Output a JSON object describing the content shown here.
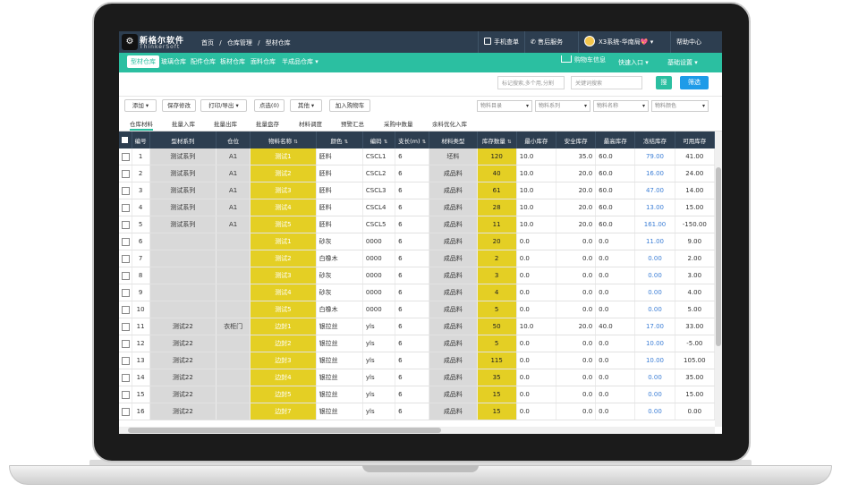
{
  "header": {
    "logo_cn": "新格尔软件",
    "logo_en": "ThinkerSoft",
    "breadcrumb": [
      "首页",
      "/",
      "仓库管理",
      "/",
      "型材仓库"
    ],
    "mobile_order": "手机查单",
    "after_sales": "售后服务",
    "system_user": "X3系统-华南局💖",
    "help": "帮助中心"
  },
  "nav": {
    "items": [
      "型材仓库",
      "玻璃仓库",
      "配件仓库",
      "板材仓库",
      "面料仓库",
      "半成品仓库"
    ],
    "cart": "购物车信息",
    "quick_entry": "快速入口",
    "settings": "基础设置"
  },
  "search": {
    "tag_placeholder": "标记搜索,多个用,分割",
    "keyword_placeholder": "关键词搜索",
    "search_btn": "搜",
    "filter_btn": "筛选"
  },
  "toolbar": {
    "add": "添加",
    "save": "保存修改",
    "print": "打印/导出",
    "selected": "点选(0)",
    "other": "其他",
    "add_cart": "加入购物车",
    "selects": [
      "物料目录",
      "物料系列",
      "物料名称",
      "物料颜色"
    ]
  },
  "subtabs": [
    "仓库材料",
    "批量入库",
    "批量出库",
    "批量盘存",
    "材料调度",
    "预警汇总",
    "采购中数量",
    "余料优化入库"
  ],
  "table": {
    "headers": [
      "编号",
      "型材系列",
      "仓位",
      "物料名称",
      "颜色",
      "编码",
      "支长(m)",
      "材料类型",
      "库存数量",
      "最小库存",
      "安全库存",
      "最高库存",
      "冻结库存",
      "可用库存"
    ],
    "rows": [
      [
        "1",
        "测试系列",
        "A1",
        "测试1",
        "胚料",
        "CSCL1",
        "6",
        "坯料",
        "120",
        "10.0",
        "35.0",
        "60.0",
        "79.00",
        "41.00"
      ],
      [
        "2",
        "测试系列",
        "A1",
        "测试2",
        "胚料",
        "CSCL2",
        "6",
        "成品料",
        "40",
        "10.0",
        "20.0",
        "60.0",
        "16.00",
        "24.00"
      ],
      [
        "3",
        "测试系列",
        "A1",
        "测试3",
        "胚料",
        "CSCL3",
        "6",
        "成品料",
        "61",
        "10.0",
        "20.0",
        "60.0",
        "47.00",
        "14.00"
      ],
      [
        "4",
        "测试系列",
        "A1",
        "测试4",
        "胚料",
        "CSCL4",
        "6",
        "成品料",
        "28",
        "10.0",
        "20.0",
        "60.0",
        "13.00",
        "15.00"
      ],
      [
        "5",
        "测试系列",
        "A1",
        "测试5",
        "胚料",
        "CSCL5",
        "6",
        "成品料",
        "11",
        "10.0",
        "20.0",
        "60.0",
        "161.00",
        "-150.00"
      ],
      [
        "6",
        "",
        "",
        "测试1",
        "砂灰",
        "0000",
        "6",
        "成品料",
        "20",
        "0.0",
        "0.0",
        "0.0",
        "11.00",
        "9.00"
      ],
      [
        "7",
        "",
        "",
        "测试2",
        "白橡木",
        "0000",
        "6",
        "成品料",
        "2",
        "0.0",
        "0.0",
        "0.0",
        "0.00",
        "2.00"
      ],
      [
        "8",
        "",
        "",
        "测试3",
        "砂灰",
        "0000",
        "6",
        "成品料",
        "3",
        "0.0",
        "0.0",
        "0.0",
        "0.00",
        "3.00"
      ],
      [
        "9",
        "",
        "",
        "测试4",
        "砂灰",
        "0000",
        "6",
        "成品料",
        "4",
        "0.0",
        "0.0",
        "0.0",
        "0.00",
        "4.00"
      ],
      [
        "10",
        "",
        "",
        "测试5",
        "白橡木",
        "0000",
        "6",
        "成品料",
        "5",
        "0.0",
        "0.0",
        "0.0",
        "0.00",
        "5.00"
      ],
      [
        "11",
        "测试22",
        "衣柜门",
        "边封1",
        "银拉丝",
        "yls",
        "6",
        "成品料",
        "50",
        "10.0",
        "20.0",
        "40.0",
        "17.00",
        "33.00"
      ],
      [
        "12",
        "测试22",
        "",
        "边封2",
        "银拉丝",
        "yls",
        "6",
        "成品料",
        "5",
        "0.0",
        "0.0",
        "0.0",
        "10.00",
        "-5.00"
      ],
      [
        "13",
        "测试22",
        "",
        "边封3",
        "银拉丝",
        "yls",
        "6",
        "成品料",
        "115",
        "0.0",
        "0.0",
        "0.0",
        "10.00",
        "105.00"
      ],
      [
        "14",
        "测试22",
        "",
        "边封4",
        "银拉丝",
        "yls",
        "6",
        "成品料",
        "35",
        "0.0",
        "0.0",
        "0.0",
        "0.00",
        "35.00"
      ],
      [
        "15",
        "测试22",
        "",
        "边封5",
        "银拉丝",
        "yls",
        "6",
        "成品料",
        "15",
        "0.0",
        "0.0",
        "0.0",
        "0.00",
        "15.00"
      ],
      [
        "16",
        "测试22",
        "",
        "边封7",
        "银拉丝",
        "yls",
        "6",
        "成品料",
        "15",
        "0.0",
        "0.0",
        "0.0",
        "0.00",
        "0.00"
      ]
    ]
  },
  "colors": {
    "header_bg": "#2d3e50",
    "nav_bg": "#2bbfa1",
    "highlight": "#e4cf24",
    "link": "#3d7fd6"
  }
}
